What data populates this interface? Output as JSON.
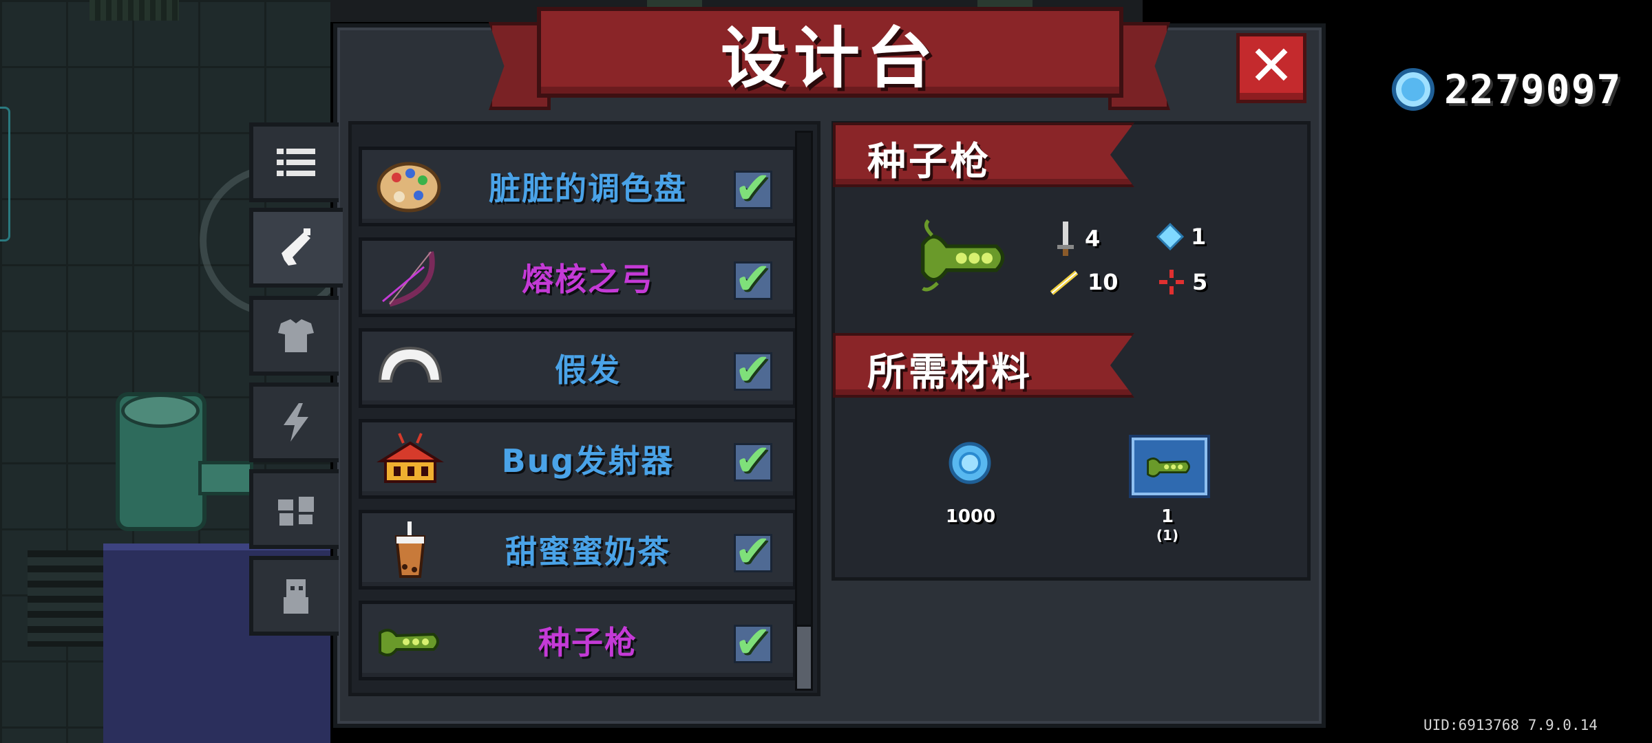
{
  "header": {
    "title": "设计台",
    "close_label": "✕"
  },
  "tabs": [
    {
      "icon": "list-icon"
    },
    {
      "icon": "weapon-icon",
      "active": true
    },
    {
      "icon": "armor-icon"
    },
    {
      "icon": "lightning-icon"
    },
    {
      "icon": "furniture-icon"
    },
    {
      "icon": "character-icon"
    }
  ],
  "list": {
    "items": [
      {
        "name": "脏脏的调色盘",
        "color": "#4aa3e8",
        "icon": "palette-icon",
        "checked": true
      },
      {
        "name": "熔核之弓",
        "color": "#c43ad6",
        "icon": "bow-icon",
        "checked": true
      },
      {
        "name": "假发",
        "color": "#4aa3e8",
        "icon": "wig-icon",
        "checked": true
      },
      {
        "name": "Bug发射器",
        "color": "#4aa3e8",
        "icon": "bug-launcher-icon",
        "checked": true
      },
      {
        "name": "甜蜜蜜奶茶",
        "color": "#4aa3e8",
        "icon": "milk-tea-icon",
        "checked": true
      },
      {
        "name": "种子枪",
        "color": "#c43ad6",
        "icon": "seed-gun-icon",
        "checked": true
      }
    ],
    "check_glyph": "✔"
  },
  "detail": {
    "item_title": "种子枪",
    "stats": {
      "damage": "4",
      "energy": "1",
      "crit": "10",
      "accuracy": "5"
    },
    "materials_title": "所需材料",
    "materials": [
      {
        "icon": "gem-icon",
        "amount": "1000"
      },
      {
        "icon": "blueprint-seed-gun-icon",
        "amount": "1",
        "sub": "(1)"
      }
    ]
  },
  "currency": {
    "icon": "gem-icon",
    "value": "2279097"
  },
  "footer": {
    "uid": "UID:6913768 7.9.0.14"
  },
  "colors": {
    "banner": "#8a2528",
    "close": "#c42a2d",
    "blue_text": "#4aa3e8",
    "purple_text": "#c43ad6",
    "check": "#7fe07a"
  }
}
